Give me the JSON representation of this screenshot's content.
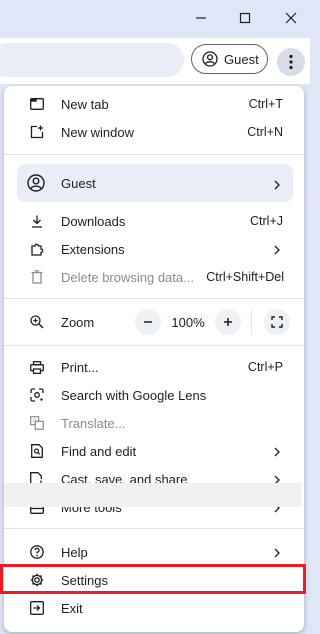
{
  "window": {
    "minimize_icon": "minimize-icon",
    "maximize_icon": "maximize-icon",
    "close_icon": "close-icon"
  },
  "toolbar": {
    "profile_label": "Guest"
  },
  "menu": {
    "new_tab": {
      "label": "New tab",
      "shortcut": "Ctrl+T"
    },
    "new_window": {
      "label": "New window",
      "shortcut": "Ctrl+N"
    },
    "guest": {
      "label": "Guest"
    },
    "downloads": {
      "label": "Downloads",
      "shortcut": "Ctrl+J"
    },
    "extensions": {
      "label": "Extensions"
    },
    "delete_browsing": {
      "label": "Delete browsing data...",
      "shortcut": "Ctrl+Shift+Del"
    },
    "zoom": {
      "label": "Zoom",
      "value": "100%",
      "minus": "−",
      "plus": "+"
    },
    "print": {
      "label": "Print...",
      "shortcut": "Ctrl+P"
    },
    "lens": {
      "label": "Search with Google Lens"
    },
    "translate": {
      "label": "Translate..."
    },
    "find_edit": {
      "label": "Find and edit"
    },
    "cast": {
      "label": "Cast, save, and share"
    },
    "more_tools": {
      "label": "More tools"
    },
    "help": {
      "label": "Help"
    },
    "settings": {
      "label": "Settings"
    },
    "exit": {
      "label": "Exit"
    }
  },
  "colors": {
    "accent_highlight": "#e31e24",
    "titlebar": "#dfe6f7",
    "guest_row": "#e8edf7"
  }
}
